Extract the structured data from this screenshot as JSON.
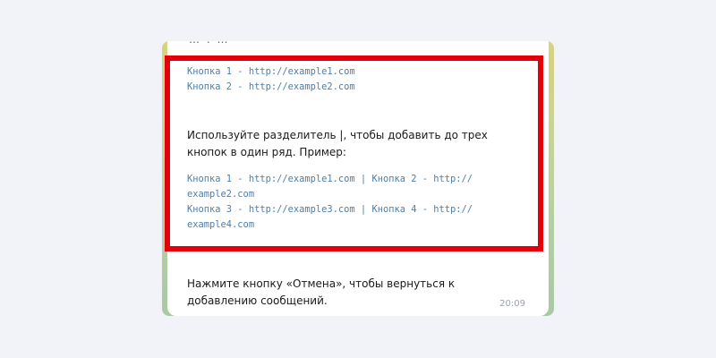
{
  "message": {
    "cut_top_text": "…  ,  …",
    "code_links_1": [
      "Кнопка 1 - http://example1.com",
      "Кнопка 2 - http://example2.com"
    ],
    "instruction": "Используйте разделитель |, чтобы добавить до трех кнопок в один ряд. Пример:",
    "code_links_2": [
      "Кнопка 1 - http://example1.com | Кнопка 2 - http://",
      "example2.com",
      "Кнопка 3 - http://example3.com | Кнопка 4 - http://",
      "example4.com"
    ],
    "cancel_hint": "Нажмите кнопку «Отмена», чтобы вернуться к добавлению сообщений.",
    "time": "20:09"
  },
  "colors": {
    "page_bg": "#f1f3f9",
    "highlight_border": "#e3000b",
    "link_color": "#4e7ea8"
  }
}
